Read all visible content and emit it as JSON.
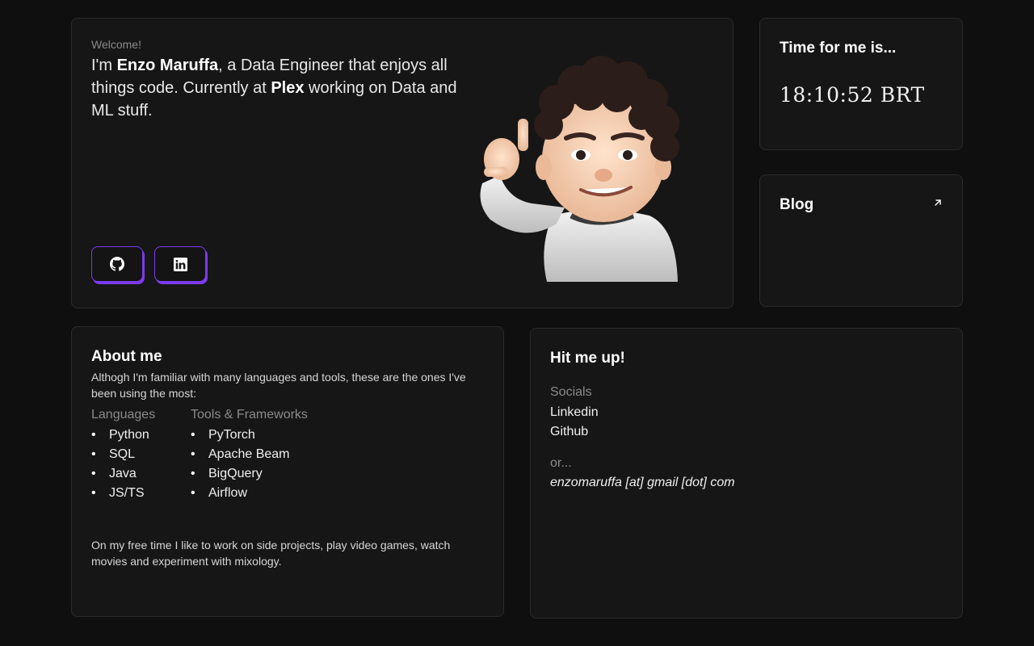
{
  "intro": {
    "welcome": "Welcome!",
    "bio_prefix": "I'm ",
    "name": "Enzo Maruffa",
    "bio_mid": ", a Data Engineer that enjoys all things code. Currently at ",
    "company": "Plex",
    "bio_suffix": " working on Data and ML stuff."
  },
  "clock": {
    "title": "Time for me is...",
    "time": "18:10:52 BRT"
  },
  "blog": {
    "title": "Blog"
  },
  "about": {
    "title": "About me",
    "description": "Althogh I'm familiar with many languages and tools, these are the ones I've been using the most:",
    "languages": {
      "heading": "Languages",
      "items": [
        "Python",
        "SQL",
        "Java",
        "JS/TS"
      ]
    },
    "tools": {
      "heading": "Tools & Frameworks",
      "items": [
        "PyTorch",
        "Apache Beam",
        "BigQuery",
        "Airflow"
      ]
    },
    "free_time": "On my free time I like to work on side projects, play video games, watch movies and experiment with mixology."
  },
  "contact": {
    "title": "Hit me up!",
    "socials_label": "Socials",
    "linkedin": "Linkedin",
    "github": "Github",
    "or_label": "or...",
    "email": "enzomaruffa [at] gmail [dot] com"
  },
  "colors": {
    "accent": "#7c3aed",
    "background": "#0f0f0f",
    "card": "#161616"
  },
  "icons": {
    "github": "github-icon",
    "linkedin": "linkedin-icon",
    "external": "arrow-up-right-icon"
  }
}
